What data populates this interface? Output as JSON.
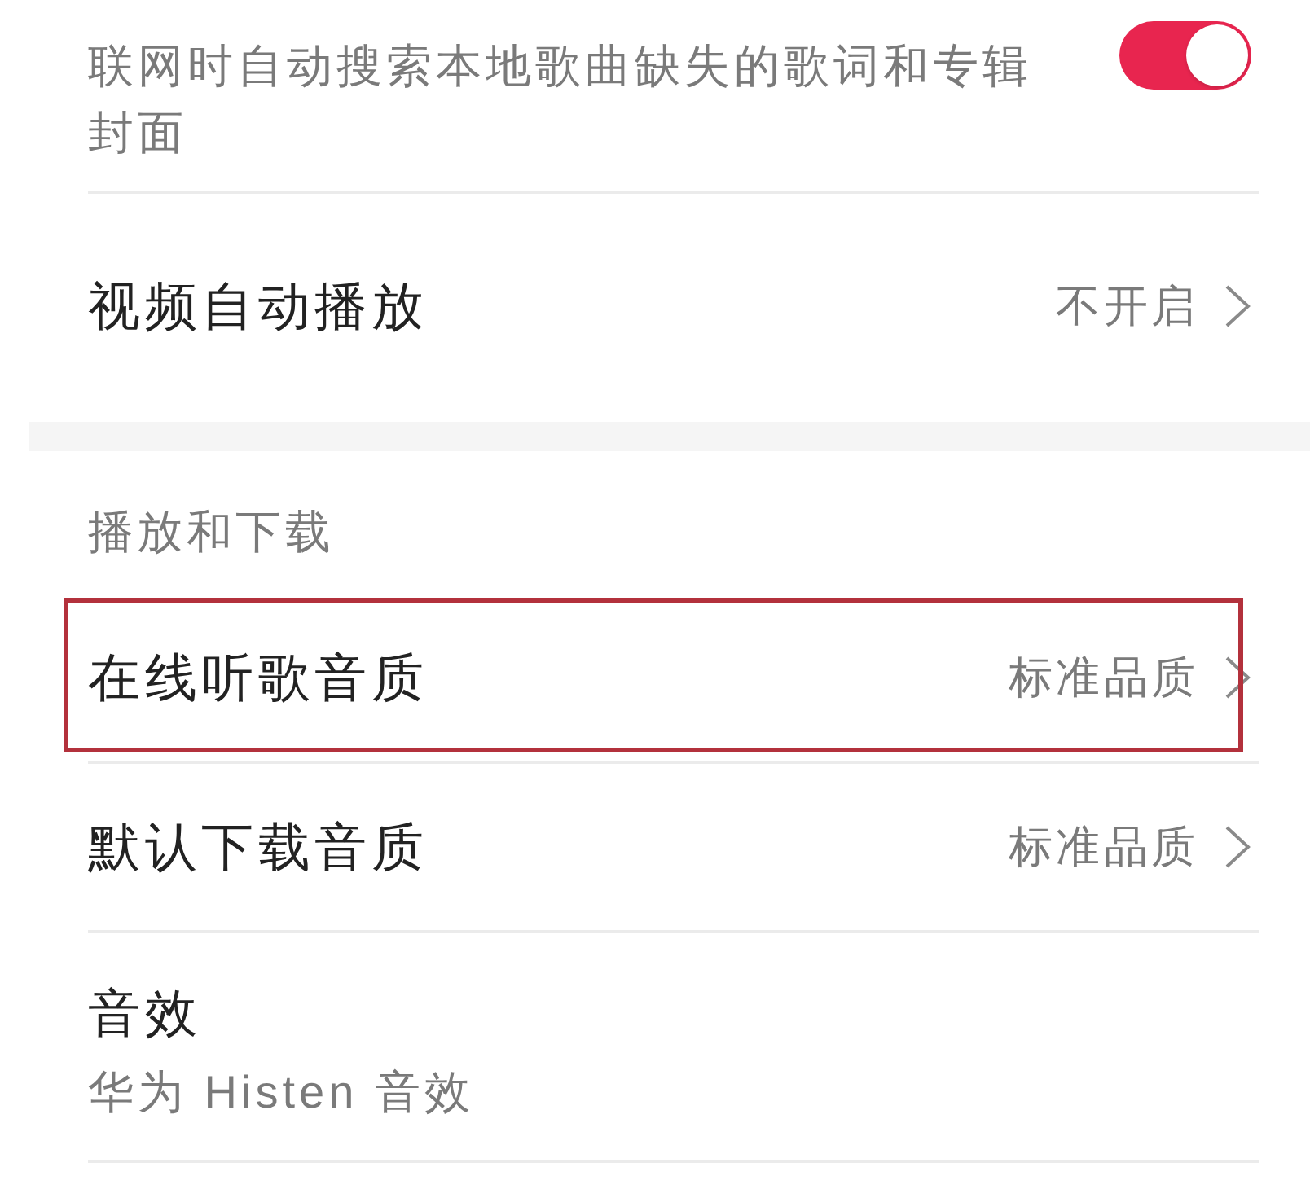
{
  "sections": [
    {
      "items": [
        {
          "kind": "toggle",
          "subtitle": "联网时自动搜索本地歌曲缺失的歌词和专辑封面",
          "on": true,
          "highlighted": false
        },
        {
          "kind": "link",
          "title": "视频自动播放",
          "value": "不开启",
          "highlighted": false
        }
      ]
    },
    {
      "header": "播放和下载",
      "items": [
        {
          "kind": "link",
          "title": "在线听歌音质",
          "value": "标准品质",
          "highlighted": true
        },
        {
          "kind": "link",
          "title": "默认下载音质",
          "value": "标准品质",
          "highlighted": false
        },
        {
          "kind": "detail",
          "title": "音效",
          "subtitle": "华为 Histen 音效",
          "highlighted": false
        }
      ]
    }
  ]
}
